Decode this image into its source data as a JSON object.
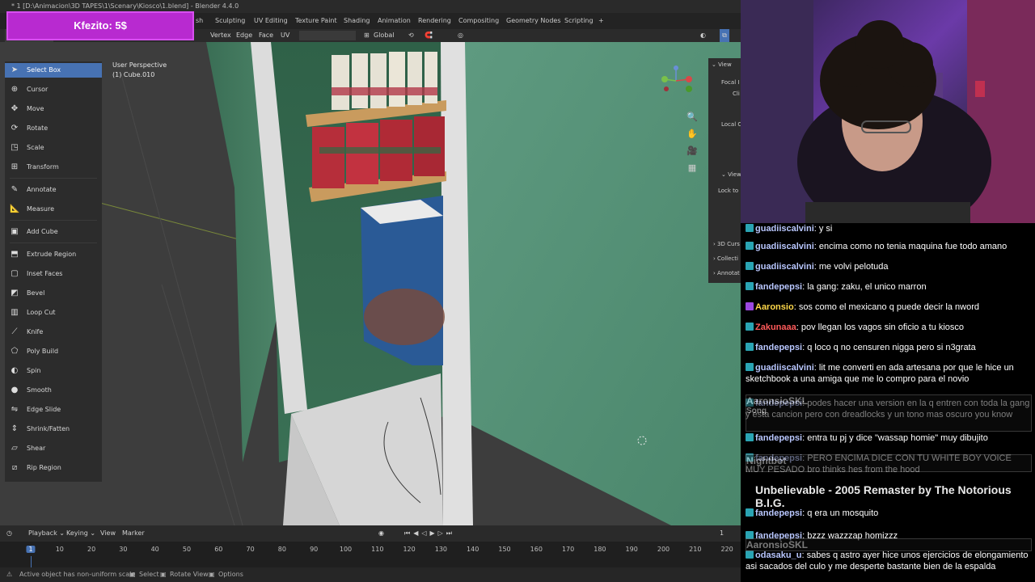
{
  "window": {
    "title": "* 1 [D:\\Animacion\\3D TAPES\\1\\Scenary\\Kiosco\\1.blend] - Blender 4.4.0"
  },
  "donation": {
    "text": "Kfezito: 5$"
  },
  "workspaces": [
    "sh",
    "Sculpting",
    "UV Editing",
    "Texture Paint",
    "Shading",
    "Animation",
    "Rendering",
    "Compositing",
    "Geometry Nodes",
    "Scripting",
    "+"
  ],
  "header3d": {
    "menus": [
      "Vertex",
      "Edge",
      "Face",
      "UV"
    ],
    "orientation": "Global"
  },
  "viewport": {
    "view_name": "User Perspective",
    "object_name": "(1) Cube.010"
  },
  "tools": [
    {
      "label": "Select Box",
      "icon": "cursor-arrow-icon",
      "glyph": "➤",
      "active": true
    },
    {
      "label": "Cursor",
      "icon": "cursor-icon",
      "glyph": "⊕"
    },
    {
      "label": "Move",
      "icon": "move-icon",
      "glyph": "✥"
    },
    {
      "label": "Rotate",
      "icon": "rotate-icon",
      "glyph": "⟳"
    },
    {
      "label": "Scale",
      "icon": "scale-icon",
      "glyph": "◳"
    },
    {
      "label": "Transform",
      "icon": "transform-icon",
      "glyph": "⊞"
    },
    {
      "label": "Annotate",
      "icon": "annotate-icon",
      "glyph": "✎"
    },
    {
      "label": "Measure",
      "icon": "measure-icon",
      "glyph": "📐"
    },
    {
      "label": "Add Cube",
      "icon": "add-cube-icon",
      "glyph": "▣"
    },
    {
      "label": "Extrude Region",
      "icon": "extrude-icon",
      "glyph": "⬒"
    },
    {
      "label": "Inset Faces",
      "icon": "inset-icon",
      "glyph": "▢"
    },
    {
      "label": "Bevel",
      "icon": "bevel-icon",
      "glyph": "◩"
    },
    {
      "label": "Loop Cut",
      "icon": "loop-cut-icon",
      "glyph": "▥"
    },
    {
      "label": "Knife",
      "icon": "knife-icon",
      "glyph": "⟋"
    },
    {
      "label": "Poly Build",
      "icon": "poly-build-icon",
      "glyph": "⬠"
    },
    {
      "label": "Spin",
      "icon": "spin-icon",
      "glyph": "◐"
    },
    {
      "label": "Smooth",
      "icon": "smooth-icon",
      "glyph": "●"
    },
    {
      "label": "Edge Slide",
      "icon": "edge-slide-icon",
      "glyph": "⇋"
    },
    {
      "label": "Shrink/Fatten",
      "icon": "shrink-fatten-icon",
      "glyph": "⇕"
    },
    {
      "label": "Shear",
      "icon": "shear-icon",
      "glyph": "▱"
    },
    {
      "label": "Rip Region",
      "icon": "rip-icon",
      "glyph": "⧄"
    }
  ],
  "npanel": {
    "view_header": "View",
    "focal": "Focal I",
    "clip": "Cli",
    "local": "Local C",
    "view2": "View",
    "lock": "Lock to",
    "cursor": "3D Curs",
    "collection": "Collecti",
    "annotations": "Annotat"
  },
  "timeline": {
    "menus": [
      "Playback",
      "Keying",
      "View",
      "Marker"
    ],
    "current_frame": "1",
    "frames": [
      "1",
      "10",
      "20",
      "30",
      "40",
      "50",
      "60",
      "70",
      "80",
      "90",
      "100",
      "110",
      "120",
      "130",
      "140",
      "150",
      "160",
      "170",
      "180",
      "190",
      "200",
      "210",
      "220"
    ]
  },
  "status": {
    "message": "Active object has non-uniform scale",
    "select": "Select",
    "rotate_view": "Rotate View",
    "options": "Options"
  },
  "chat": {
    "messages": [
      {
        "user": "guadiiscalvini",
        "color": "#b9c7ff",
        "text": "y si"
      },
      {
        "user": "guadiiscalvini",
        "color": "#b9c7ff",
        "text": "encima como no tenia maquina fue todo amano"
      },
      {
        "user": "guadiiscalvini",
        "color": "#b9c7ff",
        "text": "me volvi pelotuda"
      },
      {
        "user": "fandepepsi",
        "color": "#b9c7ff",
        "text": "la gang: zaku, el unico marron"
      },
      {
        "user": "Aaronsio",
        "color": "#ffd84a",
        "text": "sos como el mexicano q puede decir la nword"
      },
      {
        "user": "Zakunaaa",
        "color": "#ff5a5a",
        "text": "pov llegan los vagos sin oficio a tu kiosco"
      },
      {
        "user": "fandepepsi",
        "color": "#b9c7ff",
        "text": "q loco q no censuren nigga pero si n3grata"
      },
      {
        "user": "guadiiscalvini",
        "color": "#b9c7ff",
        "text": "lit me converti en ada artesana por que le hice un sketchbook a una amiga que me lo compro para el novio"
      },
      {
        "user": "fandepepsi",
        "color": "#b9c7ff",
        "text": "podes hacer una version en la q entren con toda la gang y esta cancion pero con dreadlocks y un tono mas oscuro you know"
      },
      {
        "user": "fandepepsi",
        "color": "#b9c7ff",
        "text": "entra tu pj y dice \"wassap homie\" muy dibujito"
      },
      {
        "user": "fandepepsi",
        "color": "#b9c7ff",
        "text": "PERO ENCIMA DICE CON TU WHITE BOY VOICE MUY PESADO bro thinks hes from the hood"
      },
      {
        "user": "fandepepsi",
        "color": "#b9c7ff",
        "text": "q era un mosquito"
      },
      {
        "user": "fandepepsi",
        "color": "#b9c7ff",
        "text": "bzzz wazzzap homizzz"
      },
      {
        "user": "odasaku_u",
        "color": "#b9c7ff",
        "text": "sabes q astro ayer hice unos ejercicios de elongamiento asi sacados del culo y me desperte bastante bien de la espalda"
      }
    ],
    "alert1": "AaronsioSKL",
    "alert1_sub": "Song",
    "alert2": "Nightbot",
    "alert3": "Unbelievable - 2005 Remaster by The Notorious B.I.G.",
    "alert4": "AaronsioSKL"
  }
}
